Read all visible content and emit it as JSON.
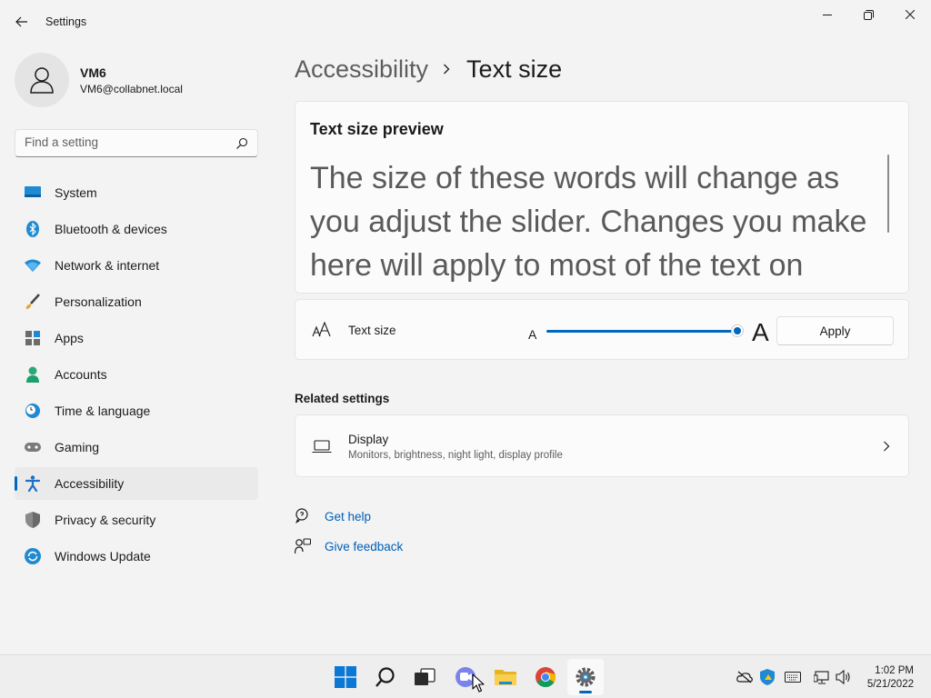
{
  "window": {
    "title": "Settings",
    "controls": {
      "minimize": "minimize",
      "maximize": "restore",
      "close": "close"
    }
  },
  "profile": {
    "name": "VM6",
    "email": "VM6@collabnet.local"
  },
  "search": {
    "placeholder": "Find a setting"
  },
  "sidebar": {
    "items": [
      {
        "label": "System",
        "icon": "monitor-icon",
        "active": false
      },
      {
        "label": "Bluetooth & devices",
        "icon": "bluetooth-icon",
        "active": false
      },
      {
        "label": "Network & internet",
        "icon": "wifi-icon",
        "active": false
      },
      {
        "label": "Personalization",
        "icon": "brush-icon",
        "active": false
      },
      {
        "label": "Apps",
        "icon": "apps-icon",
        "active": false
      },
      {
        "label": "Accounts",
        "icon": "person-icon",
        "active": false
      },
      {
        "label": "Time & language",
        "icon": "clock-globe-icon",
        "active": false
      },
      {
        "label": "Gaming",
        "icon": "gamepad-icon",
        "active": false
      },
      {
        "label": "Accessibility",
        "icon": "accessibility-icon",
        "active": true
      },
      {
        "label": "Privacy & security",
        "icon": "shield-icon",
        "active": false
      },
      {
        "label": "Windows Update",
        "icon": "update-icon",
        "active": false
      }
    ]
  },
  "breadcrumb": {
    "parent": "Accessibility",
    "current": "Text size"
  },
  "preview": {
    "title": "Text size preview",
    "body": "The size of these words will change as you adjust the slider. Changes you make here will apply to most of the text on"
  },
  "text_size": {
    "label": "Text size",
    "small_a": "A",
    "big_a": "A",
    "slider_value_fraction": 0.99,
    "apply_label": "Apply"
  },
  "related": {
    "heading": "Related settings",
    "display_title": "Display",
    "display_subtitle": "Monitors, brightness, night light, display profile"
  },
  "help": {
    "get_help": "Get help",
    "give_feedback": "Give feedback"
  },
  "taskbar": {
    "apps": [
      "start",
      "search",
      "task-view",
      "teams-chat",
      "file-explorer",
      "chrome",
      "settings"
    ],
    "active_app": "settings"
  },
  "clock": {
    "time": "1:02 PM",
    "date": "5/21/2022"
  },
  "colors": {
    "accent": "#0067c0",
    "link": "#005fb8",
    "background": "#f3f3f3",
    "card": "#fbfbfb"
  }
}
